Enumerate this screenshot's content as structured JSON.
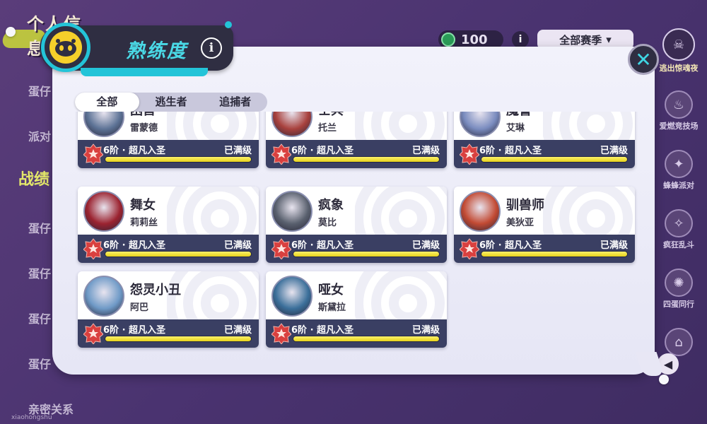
{
  "background": {
    "title": "个人信息",
    "left_items": [
      "蛋仔",
      "派对",
      "蛋仔",
      "蛋仔",
      "蛋仔",
      "蛋仔",
      "蛋仔"
    ],
    "left_section": "战绩",
    "left_bottom": "亲密关系",
    "watermark": "xiaohongshu",
    "coins": "100",
    "season_select": "全部赛季",
    "modes": [
      {
        "label": "逃出惊魂夜",
        "icon": "ghost-icon"
      },
      {
        "label": "爱燃竞技场",
        "icon": "flame-icon"
      },
      {
        "label": "蜂蜂派对",
        "icon": "bee-icon"
      },
      {
        "label": "疯狂乱斗",
        "icon": "fish-icon"
      },
      {
        "label": "四蛋同行",
        "icon": "wheel-icon"
      },
      {
        "label": "",
        "icon": "castle-icon"
      }
    ]
  },
  "modal": {
    "title": "熟练度",
    "info_symbol": "i",
    "close_symbol": "✕",
    "tabs": [
      "全部",
      "逃生者",
      "追捕者"
    ],
    "active_tab": 0,
    "characters": [
      {
        "name": "困兽",
        "player": "雷蒙德",
        "level": "6阶 · 超凡入圣",
        "status": "已满级",
        "progress": 1.0,
        "avatar_color": "#5d7396"
      },
      {
        "name": "士兵",
        "player": "托兰",
        "level": "6阶 · 超凡入圣",
        "status": "已满级",
        "progress": 1.0,
        "avatar_color": "#a8413d"
      },
      {
        "name": "魔警",
        "player": "艾琳",
        "level": "6阶 · 超凡入圣",
        "status": "已满级",
        "progress": 1.0,
        "avatar_color": "#7a8cbf"
      },
      {
        "name": "舞女",
        "player": "莉莉丝",
        "level": "6阶 · 超凡入圣",
        "status": "已满级",
        "progress": 1.0,
        "avatar_color": "#9b2330"
      },
      {
        "name": "疯象",
        "player": "莫比",
        "level": "6阶 · 超凡入圣",
        "status": "已满级",
        "progress": 1.0,
        "avatar_color": "#59606e"
      },
      {
        "name": "驯兽师",
        "player": "美狄亚",
        "level": "6阶 · 超凡入圣",
        "status": "已满级",
        "progress": 1.0,
        "avatar_color": "#c24a33"
      },
      {
        "name": "怨灵小丑",
        "player": "阿巴",
        "level": "6阶 · 超凡入圣",
        "status": "已满级",
        "progress": 1.0,
        "avatar_color": "#6f9ac7"
      },
      {
        "name": "哑女",
        "player": "斯黛拉",
        "level": "6阶 · 超凡入圣",
        "status": "已满级",
        "progress": 1.0,
        "avatar_color": "#3b6f9a"
      }
    ]
  },
  "colors": {
    "accent": "#23c4d8",
    "dark_panel": "#2f2e42",
    "card_bar": "#3a3f63",
    "progress_fill": "#f2e030",
    "rank_badge": "#d9403f"
  }
}
